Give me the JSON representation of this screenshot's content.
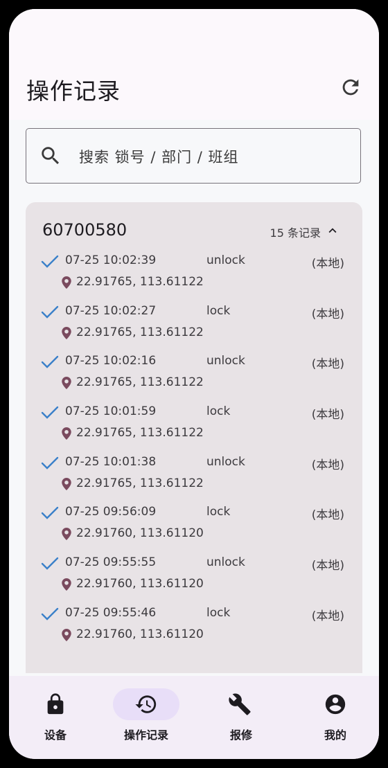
{
  "header": {
    "title": "操作记录",
    "refresh_icon": "refresh-icon"
  },
  "search": {
    "placeholder": "搜索 锁号 / 部门 / 班组",
    "icon": "search-icon"
  },
  "group": {
    "lock_id": "60700580",
    "count_label": "15 条记录",
    "expanded": true,
    "records": [
      {
        "time": "07-25 10:02:39",
        "action": "unlock",
        "source": "(本地)",
        "coords": "22.91765, 113.61122"
      },
      {
        "time": "07-25 10:02:27",
        "action": "lock",
        "source": "(本地)",
        "coords": "22.91765, 113.61122"
      },
      {
        "time": "07-25 10:02:16",
        "action": "unlock",
        "source": "(本地)",
        "coords": "22.91765, 113.61122"
      },
      {
        "time": "07-25 10:01:59",
        "action": "lock",
        "source": "(本地)",
        "coords": "22.91765, 113.61122"
      },
      {
        "time": "07-25 10:01:38",
        "action": "unlock",
        "source": "(本地)",
        "coords": "22.91765, 113.61122"
      },
      {
        "time": "07-25 09:56:09",
        "action": "lock",
        "source": "(本地)",
        "coords": "22.91760, 113.61120"
      },
      {
        "time": "07-25 09:55:55",
        "action": "unlock",
        "source": "(本地)",
        "coords": "22.91760, 113.61120"
      },
      {
        "time": "07-25 09:55:46",
        "action": "lock",
        "source": "(本地)",
        "coords": "22.91760, 113.61120"
      }
    ]
  },
  "nav": {
    "items": [
      {
        "label": "设备",
        "icon": "lock-icon"
      },
      {
        "label": "操作记录",
        "icon": "history-icon",
        "active": true
      },
      {
        "label": "报修",
        "icon": "wrench-icon"
      },
      {
        "label": "我的",
        "icon": "account-icon"
      }
    ]
  },
  "colors": {
    "check": "#3a80c9",
    "pin": "#7a4a5e",
    "active_pill": "#e8def8"
  }
}
